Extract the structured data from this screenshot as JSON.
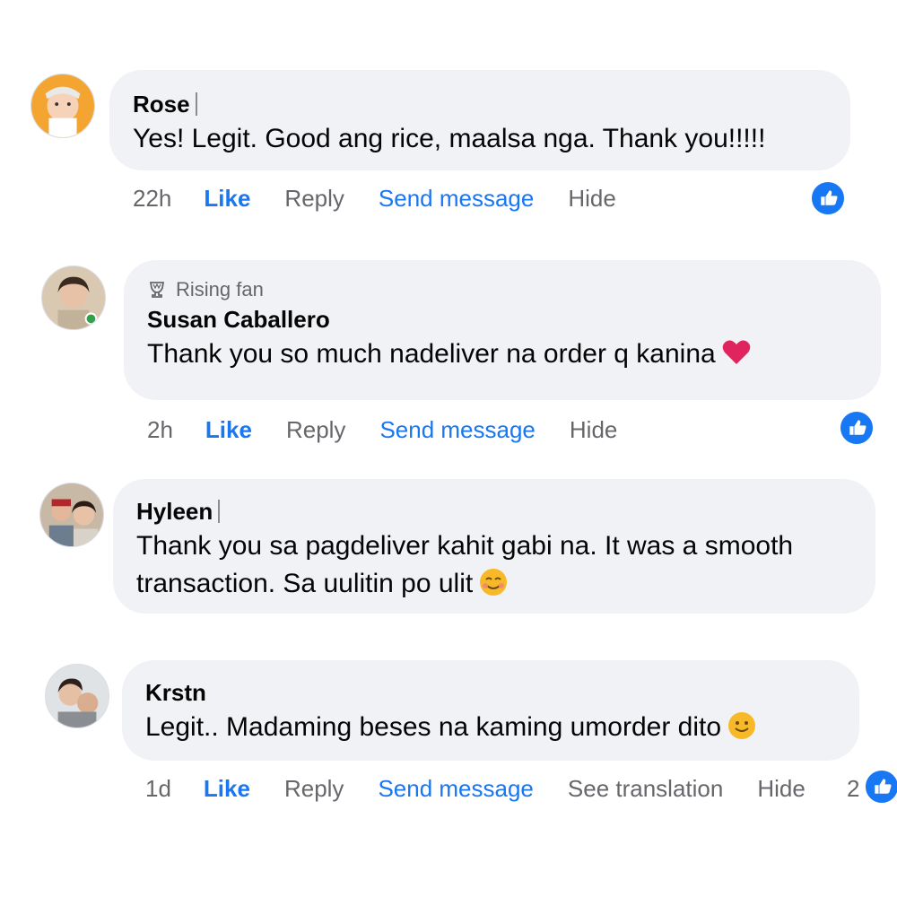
{
  "comments": [
    {
      "name": "Rose",
      "text": "Yes! Legit. Good ang rice, maalsa nga. Thank you!!!!!",
      "time": "22h",
      "like": "Like",
      "reply": "Reply",
      "send": "Send message",
      "hide": "Hide",
      "reaction_icon": "like-icon"
    },
    {
      "badge": "Rising fan",
      "badge_icon": "trophy-icon",
      "name": "Susan Caballero",
      "text": "Thank you so much nadeliver na order q kanina",
      "emoji": "heart-icon",
      "time": "2h",
      "like": "Like",
      "reply": "Reply",
      "send": "Send message",
      "hide": "Hide",
      "reaction_icon": "like-icon"
    },
    {
      "name": "Hyleen",
      "text_line1": "Thank you sa pagdeliver kahit gabi na. It was a smooth",
      "text_line2": "transaction. Sa uulitin po ulit",
      "emoji": "smiling-face-icon"
    },
    {
      "name": "Krstn",
      "text": "Legit.. Madaming beses na kaming umorder dito",
      "emoji": "smile-icon",
      "time": "1d",
      "like": "Like",
      "reply": "Reply",
      "send": "Send message",
      "translate": "See translation",
      "hide": "Hide",
      "reaction_count": "2",
      "reaction_icon": "like-icon"
    }
  ],
  "colors": {
    "bubble": "#f0f2f5",
    "accent": "#1877f2",
    "muted": "#65676b",
    "text": "#050505"
  }
}
